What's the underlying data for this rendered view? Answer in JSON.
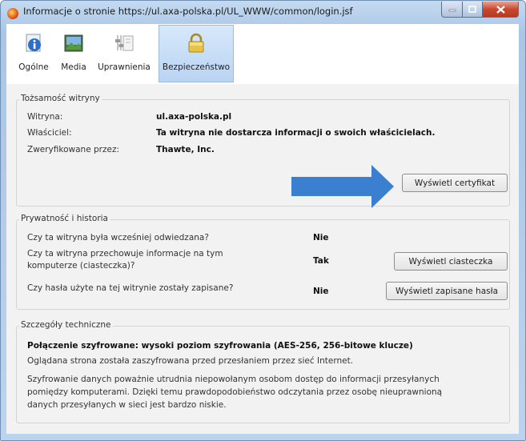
{
  "window": {
    "title": "Informacje o stronie https://ul.axa-polska.pl/UL_WWW/common/login.jsf"
  },
  "tabs": [
    {
      "label": "Ogólne",
      "icon": "info-page-icon"
    },
    {
      "label": "Media",
      "icon": "media-picture-icon"
    },
    {
      "label": "Uprawnienia",
      "icon": "permissions-sliders-icon"
    },
    {
      "label": "Bezpieczeństwo",
      "icon": "padlock-icon",
      "selected": true
    }
  ],
  "identity": {
    "group_label": "Tożsamość witryny",
    "site_label": "Witryna:",
    "site_value": "ul.axa-polska.pl",
    "owner_label": "Właściciel:",
    "owner_value": "Ta witryna nie dostarcza informacji o swoich właścicielach.",
    "verified_label": "Zweryfikowane przez:",
    "verified_value": "Thawte, Inc.",
    "cert_button": "Wyświetl certyfikat"
  },
  "privacy": {
    "group_label": "Prywatność i historia",
    "q1": "Czy ta witryna była wcześniej odwiedzana?",
    "a1": "Nie",
    "q2_line1": "Czy ta witryna przechowuje informacje na tym",
    "q2_line2": "komputerze (ciasteczka)?",
    "a2": "Tak",
    "cookies_button": "Wyświetl ciasteczka",
    "q3": "Czy hasła użyte na tej witrynie zostały zapisane?",
    "a3": "Nie",
    "passwords_button": "Wyświetl zapisane hasła"
  },
  "technical": {
    "group_label": "Szczegóły techniczne",
    "headline": "Połączenie szyfrowane: wysoki poziom szyfrowania (AES-256, 256-bitowe klucze)",
    "line1": "Oglądana strona została zaszyfrowana przed przesłaniem przez sieć Internet.",
    "para_line1": "Szyfrowanie danych poważnie utrudnia niepowołanym osobom dostęp do informacji przesyłanych",
    "para_line2": "pomiędzy komputerami. Dzięki temu prawdopodobieństwo odczytania przez osobę nieuprawnioną",
    "para_line3": "danych przesyłanych w sieci jest bardzo niskie."
  },
  "colors": {
    "annotation_arrow": "#3b7fd0",
    "selected_tab": "#c8ddf6"
  }
}
